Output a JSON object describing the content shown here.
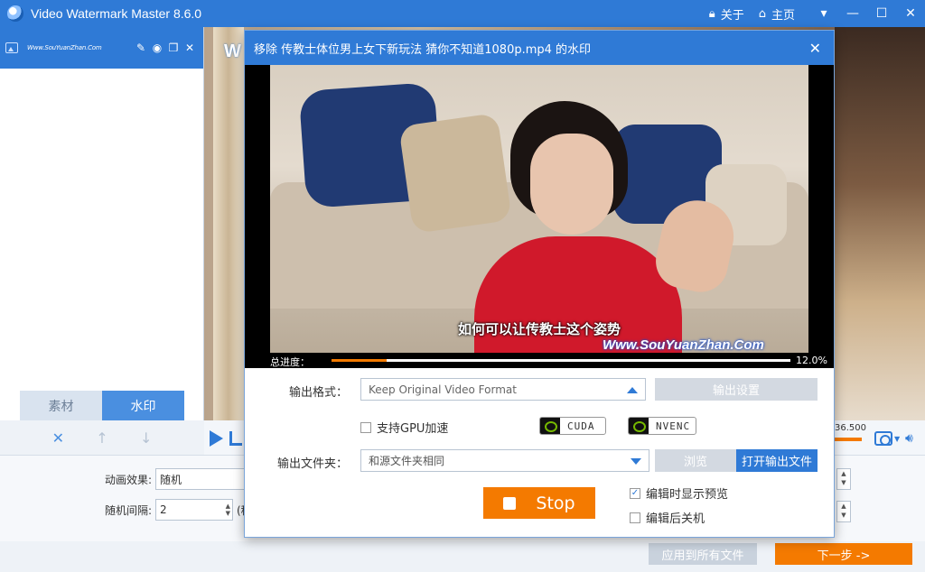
{
  "app": {
    "title": "Video Watermark Master 8.6.0",
    "about_label": "关于",
    "home_label": "主页"
  },
  "left_panel": {
    "watermark_item_text": "Www.SouYuanZhan.Com",
    "tabs": [
      {
        "label": "素材",
        "active": false
      },
      {
        "label": "水印",
        "active": true
      }
    ]
  },
  "preview": {
    "logo_letter": "W",
    "time_fragment": "36.500"
  },
  "settings": {
    "animation_label": "动画效果:",
    "animation_value": "随机",
    "interval_label": "随机间隔:",
    "interval_value": "2",
    "interval_suffix": "(秒"
  },
  "footer": {
    "apply_all_label": "应用到所有文件",
    "next_label": "下一步 ->"
  },
  "dialog": {
    "title": "移除 传教士体位男上女下新玩法 猜你不知道1080p.mp4 的水印",
    "subtitle": "如何可以让传教士这个姿势",
    "watermark_text": "Www.SouYuanZhan.Com",
    "progress_label": "总进度：",
    "progress_percent": "12.0%",
    "progress_value": 0.12,
    "output_format_label": "输出格式：",
    "output_format_value": "Keep Original Video Format",
    "output_settings_label": "输出设置",
    "gpu_label": "支持GPU加速",
    "gpu_checked": false,
    "cuda_label": "CUDA",
    "nvenc_label": "NVENC",
    "output_folder_label": "输出文件夹：",
    "output_folder_value": "和源文件夹相同",
    "browse_label": "浏览",
    "open_output_label": "打开输出文件",
    "stop_label": "Stop",
    "preview_while_editing_label": "编辑时显示预览",
    "preview_while_editing_checked": true,
    "shutdown_label": "编辑后关机",
    "shutdown_checked": false
  },
  "colors": {
    "accent": "#2f7ad6",
    "orange": "#f47a00"
  }
}
